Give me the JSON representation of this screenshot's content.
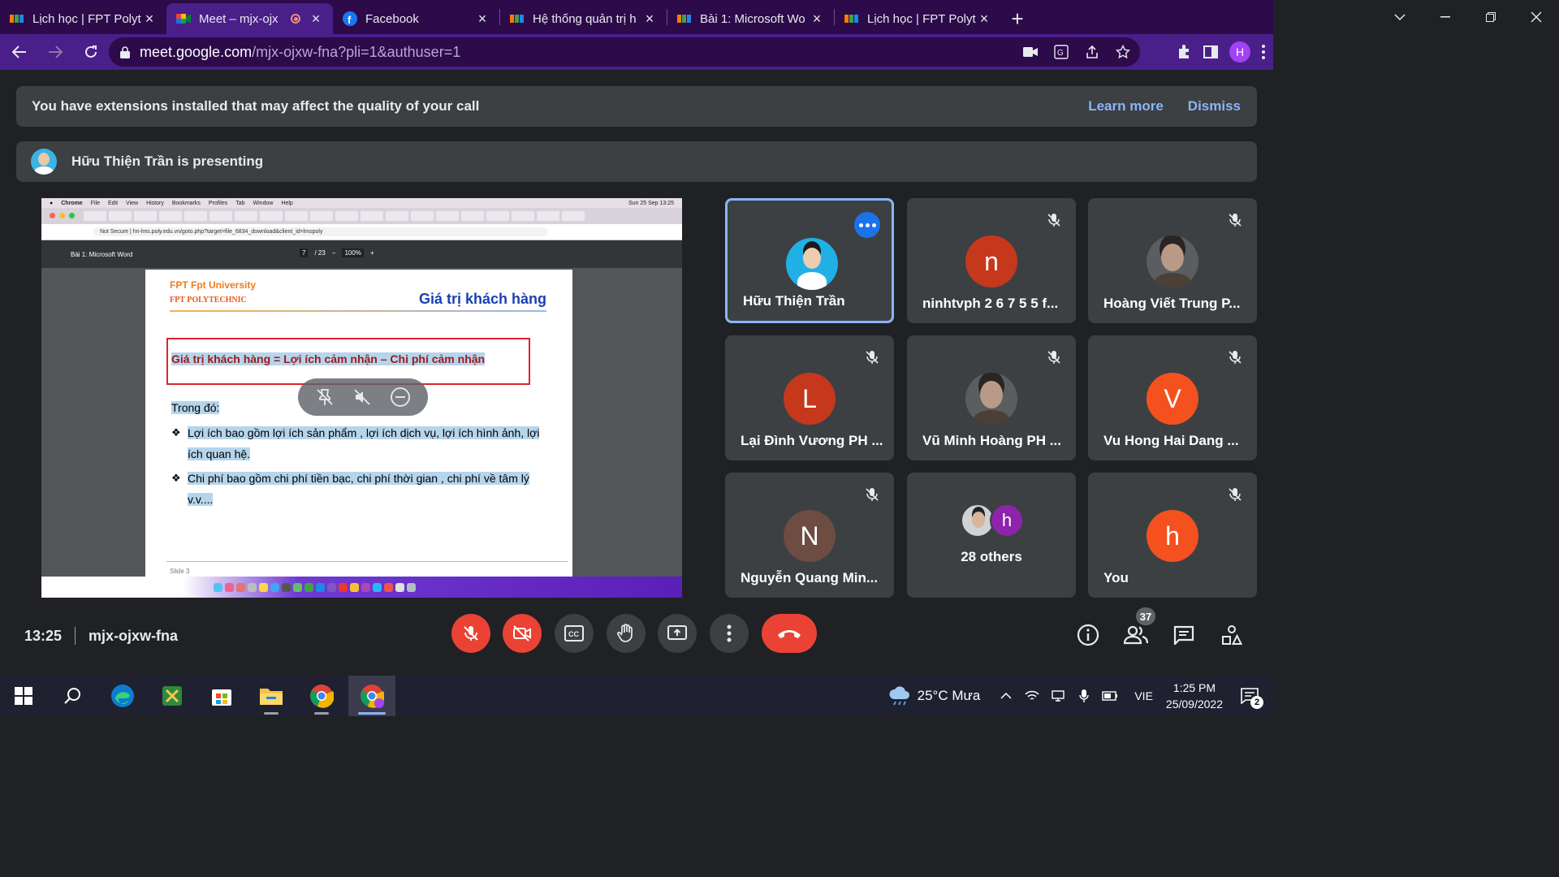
{
  "browser": {
    "tabs": [
      {
        "title": "Lịch học | FPT Polyt",
        "favicon": "fpt-icon",
        "active": false
      },
      {
        "title": "Meet – mjx-ojx",
        "favicon": "meet-icon",
        "active": true,
        "recording": true
      },
      {
        "title": "Facebook",
        "favicon": "facebook-icon",
        "active": false
      },
      {
        "title": "Hệ thống quản trị h",
        "favicon": "fpt-icon",
        "active": false
      },
      {
        "title": "Bài 1: Microsoft Wo",
        "favicon": "fpt-icon",
        "active": false
      },
      {
        "title": "Lịch học | FPT Polyt",
        "favicon": "fpt-icon",
        "active": false
      }
    ],
    "url_host": "meet.google.com",
    "url_path": "/mjx-ojxw-fna?pli=1&authuser=1",
    "profile_initial": "H",
    "colors": {
      "frame": "#2d0a4a",
      "toolbar": "#4a1f8a"
    }
  },
  "extension_banner": {
    "message": "You have extensions installed that may affect the quality of your call",
    "learn_more": "Learn more",
    "dismiss": "Dismiss"
  },
  "presenting_banner": {
    "text": "Hữu Thiện Trần is presenting"
  },
  "shared_screen": {
    "menubar": {
      "items": [
        "Chrome",
        "File",
        "Edit",
        "View",
        "History",
        "Bookmarks",
        "Profiles",
        "Tab",
        "Window",
        "Help"
      ],
      "clock": "Sun 25 Sep 13:25"
    },
    "url": "Not Secure  |  hn-lms.poly.edu.vn/goto.php?target=file_6834_download&client_id=lmspoly",
    "pdf_title": "Bài 1: Microsoft Word",
    "page_current": "7",
    "page_total": "/ 23",
    "zoom": "100%",
    "slide": {
      "brand": "FPT Fpt University",
      "brand_sub": "FPT POLYTECHNIC",
      "heading": "Giá trị khách hàng",
      "formula": "Giá trị khách hàng = Lợi ích cảm nhận – Chi phí cảm nhận",
      "subheading": "Trong đó:",
      "bullet1": "Lợi ích bao gồm lợi ích sản phẩm , lợi ích dịch vụ, lợi ích hình ảnh, lợi ích quan hệ.",
      "bullet2": "Chi phí bao gồm chi phí tiền bạc, chi phí thời gian , chi phí về tâm lý v.v....",
      "slide_number": "Slide 3"
    }
  },
  "participants": [
    {
      "name": "Hữu Thiện Trần",
      "avatar": "photo",
      "initial": "",
      "color": "#21b0e6",
      "speaking": true,
      "muted": false
    },
    {
      "name": "ninhtvph 2 6 7 5 5 f...",
      "avatar": "letter",
      "initial": "n",
      "color": "#c5381b",
      "speaking": false,
      "muted": true
    },
    {
      "name": "Hoàng Viết Trung P...",
      "avatar": "photo",
      "initial": "",
      "color": "#5b5e60",
      "speaking": false,
      "muted": true
    },
    {
      "name": "Lại Đình Vương PH ...",
      "avatar": "letter",
      "initial": "L",
      "color": "#c5381b",
      "speaking": false,
      "muted": true
    },
    {
      "name": "Vũ Minh Hoàng PH ...",
      "avatar": "photo",
      "initial": "",
      "color": "#5b5e60",
      "speaking": false,
      "muted": true
    },
    {
      "name": "Vu Hong Hai Dang ...",
      "avatar": "letter",
      "initial": "V",
      "color": "#f4511e",
      "speaking": false,
      "muted": true
    },
    {
      "name": "Nguyễn Quang Min...",
      "avatar": "letter",
      "initial": "N",
      "color": "#6d4c41",
      "speaking": false,
      "muted": true
    },
    {
      "name": "28 others",
      "avatar": "group",
      "initial": "h",
      "color": "#8e24aa",
      "speaking": false,
      "muted": false
    },
    {
      "name": "You",
      "avatar": "letter",
      "initial": "h",
      "color": "#f4511e",
      "speaking": false,
      "muted": true
    }
  ],
  "meeting_bar": {
    "time": "13:25",
    "meeting_code": "mjx-ojxw-fna",
    "people_count": "37",
    "colors": {
      "danger": "#ea4335",
      "button": "#3c4043"
    }
  },
  "taskbar": {
    "apps": [
      "windows-start-icon",
      "search-icon",
      "edge-icon",
      "snip-icon",
      "store-icon",
      "file-explorer-icon",
      "chrome-icon",
      "chrome-profile-icon"
    ],
    "weather": "25°C  Mưa",
    "language": "VIE",
    "time": "1:25 PM",
    "date": "25/09/2022",
    "notifications": "2"
  }
}
